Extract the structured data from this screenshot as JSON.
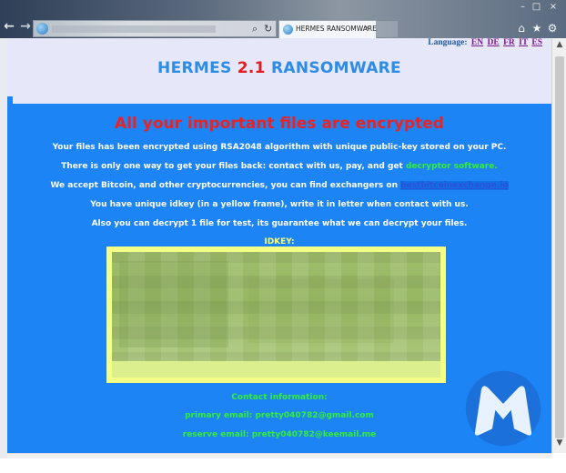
{
  "browser": {
    "tab_title": "HERMES RANSOMWARE",
    "tab_close": "×",
    "address_search_icon": "search-icon",
    "address_refresh_icon": "refresh-icon",
    "nav": {
      "back": "←",
      "forward": "→"
    },
    "window_controls": {
      "minimize": "–",
      "maximize": "□",
      "close": "×"
    },
    "command_icons": {
      "home": "⌂",
      "favorites": "★",
      "settings": "⚙"
    }
  },
  "header": {
    "language_label": "Language:",
    "languages": [
      "EN",
      "DE",
      "FR",
      "IT",
      "ES"
    ],
    "brand_name": "HERMES",
    "brand_version": "2.1",
    "brand_suffix": "RANSOMWARE"
  },
  "main": {
    "headline": "All your important files are encrypted",
    "line1": "Your files has been encrypted using RSA2048 algorithm with unique public-key stored on your PC.",
    "line2_a": "There is  only one way  to get your files back:  contact with us,  pay,  and get ",
    "line2_b": "decryptor software.",
    "line3_a": "We accept Bitcoin, and other cryptocurrencies,  you can find exchangers on ",
    "line3_link": "bestbitcoinexchange.io",
    "line4": "You have unique idkey (in a yellow frame), write it in letter when contact with us.",
    "line5": "Also you can decrypt 1 file for test, its guarantee what we can decrypt your files.",
    "idkey_label": "IDKEY:",
    "contact_heading": "Contact information:",
    "primary_email": "primary email: pretty040782@gmail.com",
    "reserve_email": "reserve email: pretty040782@keemail.me"
  },
  "colors": {
    "main_background": "#1d84f5",
    "header_background": "#e6e7f8",
    "brand_blue": "#2d8ce6",
    "headline_red": "#e82323",
    "accent_green": "#33ef33",
    "idkey_yellow": "#f4ff86"
  },
  "scrollbar": {
    "up": "▲",
    "down": "▼"
  }
}
